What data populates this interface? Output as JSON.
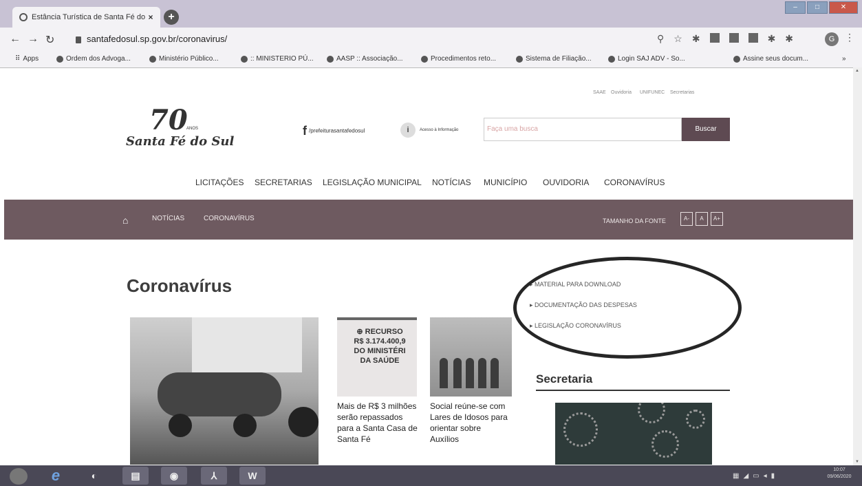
{
  "browser": {
    "tab_title": "Estância Turística de Santa Fé do",
    "tab_close": "×",
    "new_tab": "+",
    "url": "santafedosul.sp.gov.br/coronavirus/",
    "profile_initial": "G",
    "bookmarks": [
      "Apps",
      "Ordem dos Advoga...",
      "Ministério Público...",
      ":: MINISTERIO PÚ...",
      "AASP :: Associação...",
      "Procedimentos reto...",
      "Sistema de Filiação...",
      "Login SAJ ADV - So...",
      "Assine seus docum..."
    ]
  },
  "site": {
    "utility_links": [
      "SAAE",
      "Ouvidoria",
      "UNIFUNEC",
      "Secretarias"
    ],
    "logo": {
      "number": "70",
      "anos": "ANOS",
      "name": "Santa Fé do Sul"
    },
    "facebook_handle": "/prefeiturasantafedosul",
    "info_access": "Acesso à Informação",
    "search": {
      "placeholder": "Faça uma busca",
      "button": "Buscar"
    },
    "main_nav": [
      "LICITAÇÕES",
      "SECRETARIAS",
      "LEGISLAÇÃO MUNICIPAL",
      "NOTÍCIAS",
      "MUNICÍPIO",
      "OUVIDORIA",
      "CORONAVÍRUS"
    ],
    "breadcrumb": [
      "NOTÍCIAS",
      "CORONAVÍRUS"
    ],
    "font_size": {
      "label": "TAMANHO DA FONTE",
      "buttons": [
        "A-",
        "A",
        "A+"
      ]
    },
    "page_title": "Coronavírus",
    "side_links": [
      "MATERIAL PARA DOWNLOAD",
      "DOCUMENTAÇÃO DAS DESPESAS",
      "LEGISLAÇÃO CORONAVÍRUS"
    ],
    "news_card_image_text": [
      "⊕ RECURSO",
      "R$ 3.174.400,9",
      "DO MINISTÉRI",
      "DA SAÚDE"
    ],
    "news": [
      {
        "caption": "Mais de R$ 3 milhões serão repassados para a Santa Casa de Santa Fé"
      },
      {
        "caption": "Social reúne-se com Lares de Idosos para orientar sobre Auxílios"
      }
    ],
    "sidebar_heading": "Secretaria"
  },
  "taskbar": {
    "clock_time": "10:07",
    "clock_date": "09/06/2020"
  },
  "icons": [
    "chrome-favicon",
    "back-arrow-icon",
    "forward-arrow-icon",
    "reload-icon",
    "lock-icon",
    "search-icon",
    "star-icon",
    "facebook-icon",
    "info-icon",
    "home-icon",
    "windows-start-icon",
    "ie-icon",
    "word-icon",
    "acrobat-icon"
  ]
}
